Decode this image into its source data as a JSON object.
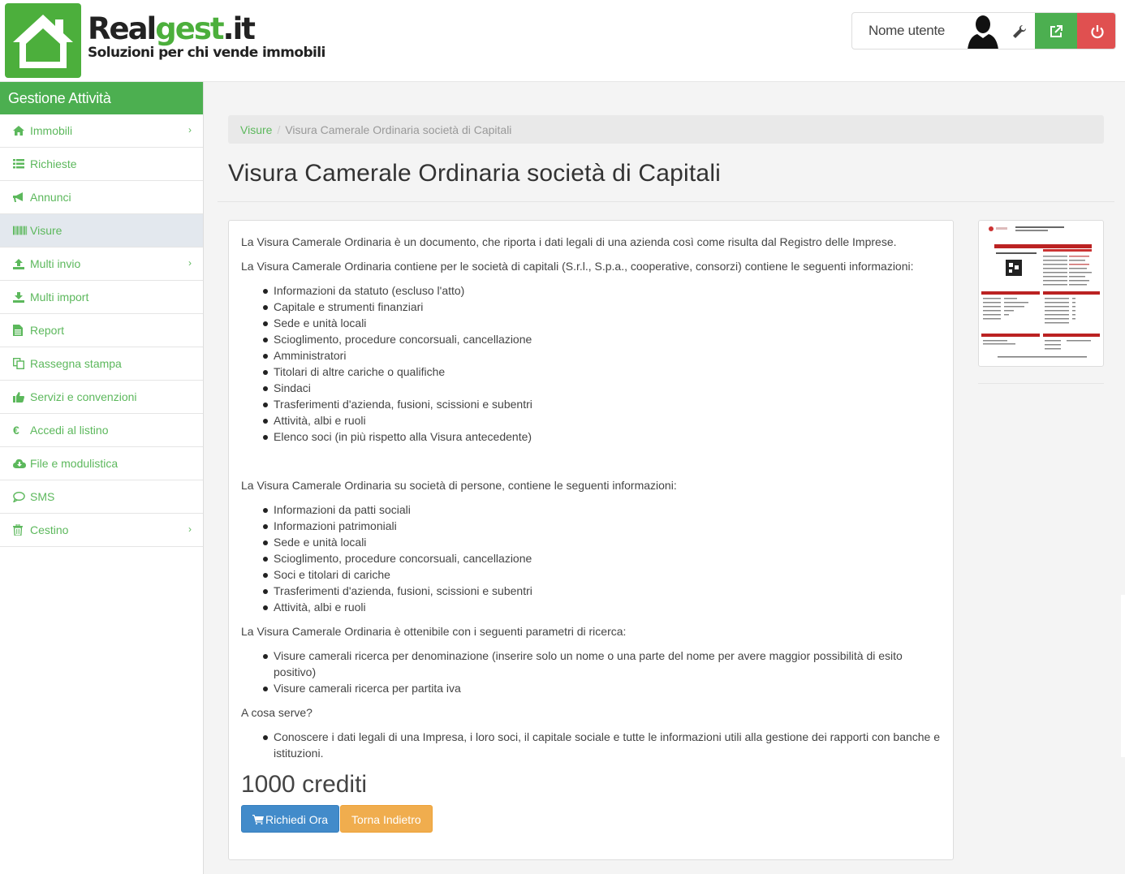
{
  "header": {
    "logo": {
      "name_part1": "Real",
      "name_part2": "gest",
      "name_part3": ".it",
      "tagline": "Soluzioni per chi vende immobili"
    },
    "user": {
      "name": "Nome utente",
      "avatar_icon": "user-silhouette-icon",
      "settings_icon": "wrench-icon",
      "external_icon": "external-link-icon",
      "power_icon": "power-icon"
    },
    "colors": {
      "green": "#4caf50",
      "red": "#e05050"
    }
  },
  "sidebar": {
    "title": "Gestione Attività",
    "items": [
      {
        "label": "Immobili",
        "icon": "home-icon",
        "chevron": true
      },
      {
        "label": "Richieste",
        "icon": "list-icon",
        "chevron": false
      },
      {
        "label": "Annunci",
        "icon": "bullhorn-icon",
        "chevron": false
      },
      {
        "label": "Visure",
        "icon": "barcode-icon",
        "chevron": false,
        "active": true
      },
      {
        "label": "Multi invio",
        "icon": "upload-icon",
        "chevron": true
      },
      {
        "label": "Multi import",
        "icon": "download-icon",
        "chevron": false
      },
      {
        "label": "Report",
        "icon": "file-icon",
        "chevron": false
      },
      {
        "label": "Rassegna stampa",
        "icon": "copy-icon",
        "chevron": false
      },
      {
        "label": "Servizi e convenzioni",
        "icon": "thumbs-up-icon",
        "chevron": false
      },
      {
        "label": "Accedi al listino",
        "icon": "euro-icon",
        "chevron": false
      },
      {
        "label": "File e modulistica",
        "icon": "cloud-download-icon",
        "chevron": false
      },
      {
        "label": "SMS",
        "icon": "comment-icon",
        "chevron": false
      },
      {
        "label": "Cestino",
        "icon": "trash-icon",
        "chevron": true
      }
    ]
  },
  "breadcrumb": {
    "link": "Visure",
    "separator": "/",
    "current": "Visura Camerale Ordinaria società di Capitali"
  },
  "page_title": "Visura Camerale Ordinaria società di Capitali",
  "content": {
    "intro": "La Visura Camerale Ordinaria è un documento, che riporta i dati legali di una azienda così come risulta dal Registro delle Imprese.",
    "capitali_intro": "La Visura Camerale Ordinaria contiene per le società di capitali (S.r.l., S.p.a., cooperative, consorzi) contiene le seguenti informazioni:",
    "capitali_list": [
      "Informazioni da statuto (escluso l'atto)",
      "Capitale e strumenti finanziari",
      "Sede e unità locali",
      "Scioglimento, procedure concorsuali, cancellazione",
      "Amministratori",
      "Titolari di altre cariche o qualifiche",
      "Sindaci",
      "Trasferimenti d'azienda, fusioni, scissioni e subentri",
      "Attività, albi e ruoli",
      "Elenco soci (in più rispetto alla Visura antecedente)"
    ],
    "persone_intro": "La Visura Camerale Ordinaria su società di persone, contiene le seguenti informazioni:",
    "persone_list": [
      "Informazioni da patti sociali",
      "Informazioni patrimoniali",
      "Sede e unità locali",
      "Scioglimento, procedure concorsuali, cancellazione",
      "Soci e titolari di cariche",
      "Trasferimenti d'azienda, fusioni, scissioni e subentri",
      "Attività, albi e ruoli"
    ],
    "ricerca_intro": "La Visura Camerale Ordinaria è ottenibile con i seguenti parametri di ricerca:",
    "ricerca_list": [
      "Visure camerali ricerca per denominazione (inserire solo un nome o una parte del nome per avere maggior possibilità di esito positivo)",
      "Visure camerali ricerca per partita iva"
    ],
    "serve_intro": "A cosa serve?",
    "serve_list": [
      "Conoscere i dati legali di una Impresa, i loro soci, il capitale sociale e tutte le informazioni utili alla gestione dei rapporti con banche e istituzioni."
    ],
    "price": "1000 crediti",
    "buttons": {
      "request": "Richiedi Ora",
      "request_icon": "cart-icon",
      "back": "Torna Indietro"
    }
  }
}
